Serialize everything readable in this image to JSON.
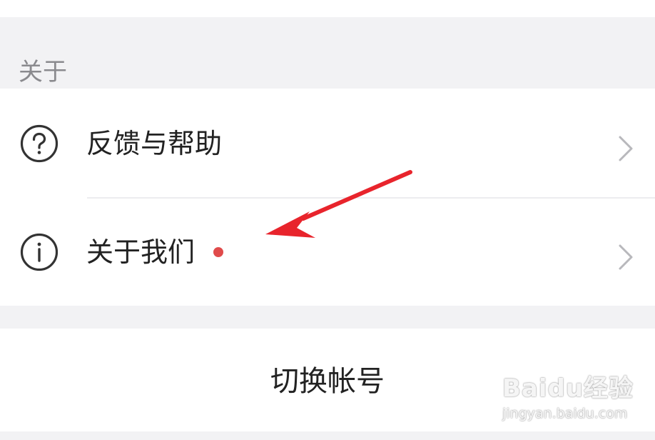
{
  "section": {
    "title": "关于"
  },
  "menu": {
    "items": [
      {
        "label": "反馈与帮助",
        "icon": "question-circle-icon"
      },
      {
        "label": "关于我们",
        "icon": "info-circle-icon",
        "badge": "red-dot"
      }
    ]
  },
  "account": {
    "switch_label": "切换帐号"
  },
  "watermark": {
    "logo": "Baidu经验",
    "domain": "jingyan.baidu.com"
  },
  "colors": {
    "background": "#f2f2f4",
    "card": "#ffffff",
    "text": "#222222",
    "muted_text": "#8a8a8e",
    "badge": "#e04b4b",
    "annotation_arrow": "#e8242c"
  }
}
